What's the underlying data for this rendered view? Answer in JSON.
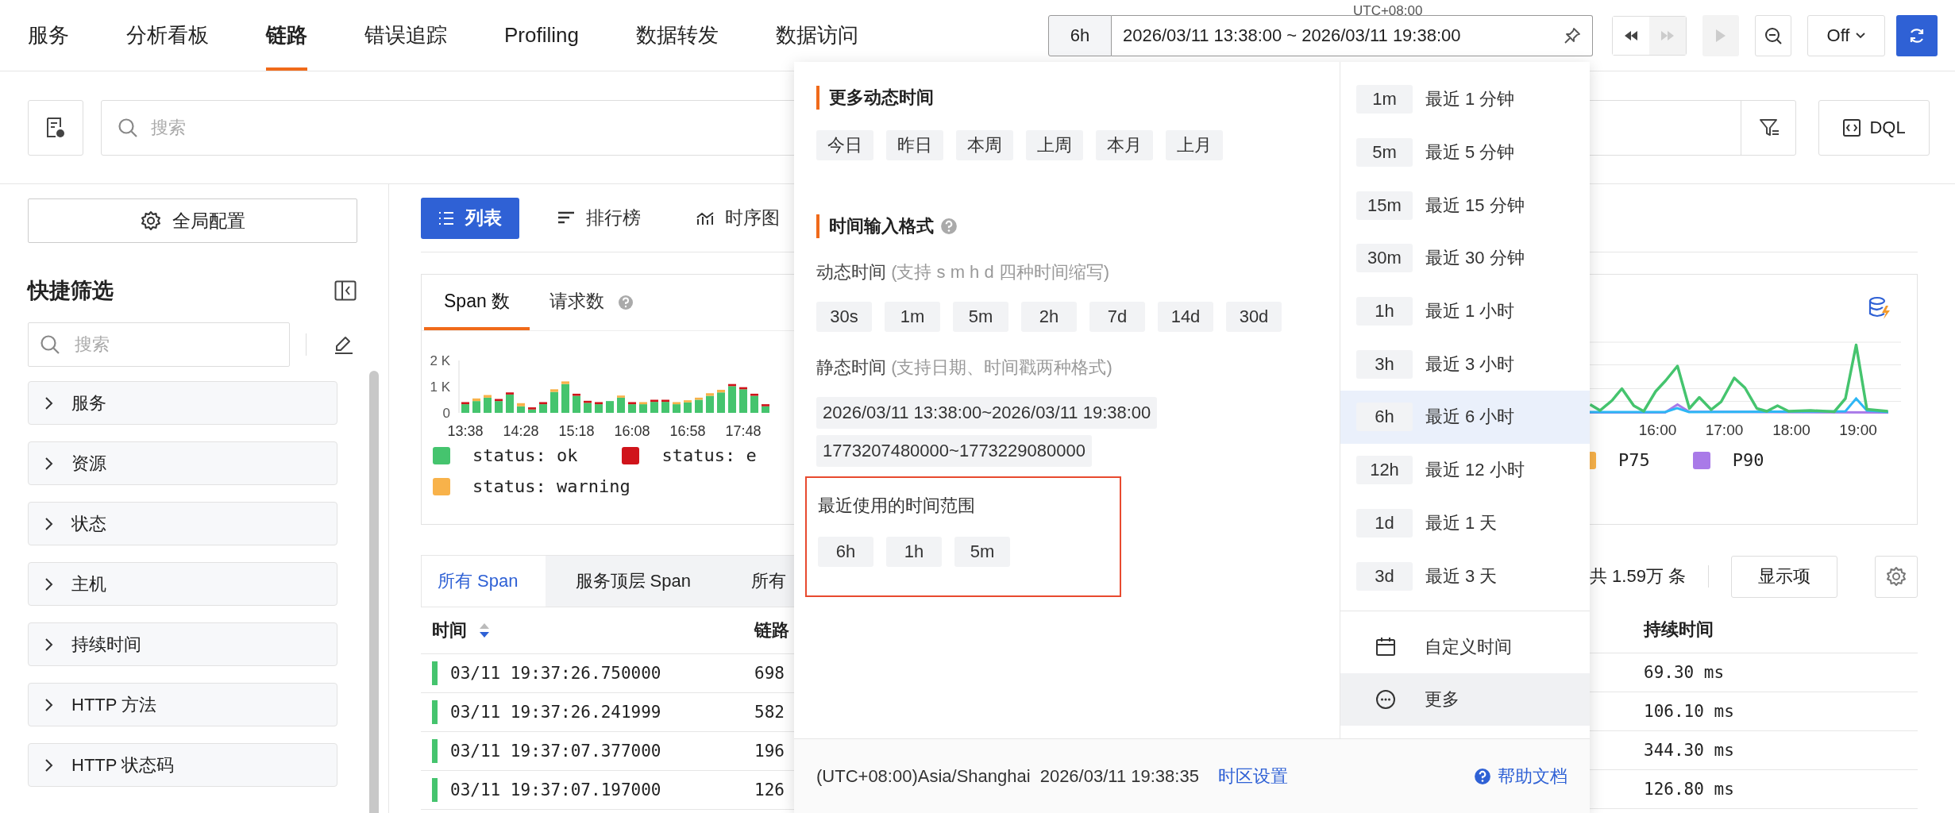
{
  "nav": {
    "tabs": [
      {
        "label": "服务",
        "selected": false
      },
      {
        "label": "分析看板",
        "selected": false
      },
      {
        "label": "链路",
        "selected": true
      },
      {
        "label": "错误追踪",
        "selected": false
      },
      {
        "label": "Profiling",
        "selected": false
      },
      {
        "label": "数据转发",
        "selected": false
      },
      {
        "label": "数据访问",
        "selected": false
      }
    ]
  },
  "time_bar": {
    "timezone": "UTC+08:00",
    "preset": "6h",
    "range": "2026/03/11 13:38:00 ~ 2026/03/11 19:38:00",
    "controls": [
      {
        "kind": "rewind",
        "disabled": false
      },
      {
        "kind": "forward",
        "disabled": true
      },
      {
        "kind": "play",
        "disabled": true
      }
    ],
    "refresh": "Off"
  },
  "search": {
    "placeholder": "搜索",
    "dql": "DQL"
  },
  "sidebar": {
    "config_button": "全局配置",
    "title": "快捷筛选",
    "search_placeholder": "搜索",
    "filters": [
      {
        "label": "服务",
        "expanded": false
      },
      {
        "label": "资源",
        "expanded": false
      },
      {
        "label": "状态",
        "expanded": false
      },
      {
        "label": "主机",
        "expanded": false
      },
      {
        "label": "持续时间",
        "expanded": false
      },
      {
        "label": "HTTP 方法",
        "expanded": false
      },
      {
        "label": "HTTP 状态码",
        "expanded": false
      }
    ]
  },
  "view_tabs": [
    {
      "kind": "list",
      "label": "列表",
      "selected": true
    },
    {
      "kind": "ranking",
      "label": "排行榜",
      "selected": false
    },
    {
      "kind": "series",
      "label": "时序图",
      "selected": false
    }
  ],
  "span_chart": {
    "tabs": [
      {
        "label": "Span 数",
        "selected": true,
        "help": false
      },
      {
        "label": "请求数",
        "selected": false,
        "help": true
      }
    ],
    "chart_data": {
      "type": "bar",
      "stacked": true,
      "categories": [
        "13:38",
        null,
        null,
        null,
        null,
        "14:28",
        null,
        null,
        null,
        null,
        "15:18",
        null,
        null,
        null,
        null,
        "16:08",
        null,
        null,
        null,
        null,
        "16:58",
        null,
        null,
        null,
        null,
        "17:48",
        null,
        null
      ],
      "ylim": [
        0,
        2000
      ],
      "yticks": [
        {
          "value": 0,
          "label": "0"
        },
        {
          "value": 1000,
          "label": "1 K"
        },
        {
          "value": 2000,
          "label": "2 K"
        }
      ],
      "series": [
        {
          "name": "status: ok",
          "color": "#45c46e",
          "values": [
            330,
            450,
            580,
            450,
            700,
            250,
            130,
            330,
            800,
            1100,
            650,
            380,
            330,
            450,
            580,
            330,
            330,
            420,
            420,
            330,
            400,
            500,
            650,
            780,
            1020,
            900,
            650,
            250
          ]
        },
        {
          "name": "status: e",
          "color": "#d0141b",
          "values": [
            80,
            0,
            0,
            80,
            80,
            0,
            80,
            80,
            0,
            0,
            80,
            80,
            80,
            0,
            0,
            80,
            0,
            80,
            80,
            0,
            0,
            0,
            0,
            0,
            80,
            80,
            80,
            80
          ]
        },
        {
          "name": "status: warning",
          "color": "#f8b24a",
          "values": [
            0,
            100,
            100,
            0,
            0,
            120,
            0,
            0,
            100,
            100,
            0,
            0,
            0,
            0,
            80,
            0,
            80,
            0,
            0,
            80,
            80,
            80,
            100,
            100,
            0,
            0,
            0,
            0
          ]
        }
      ]
    }
  },
  "latency_chart": {
    "x_labels": [
      "16:00",
      "17:00",
      "18:00",
      "19:00"
    ],
    "legend": [
      {
        "label": "P75",
        "color": "#f8b24a"
      },
      {
        "label": "P90",
        "color": "#a97ae8"
      }
    ]
  },
  "span_table": {
    "tabs": [
      {
        "label": "所有 Span",
        "selected": true
      },
      {
        "label": "服务顶层 Span",
        "selected": false
      },
      {
        "label": "所有",
        "selected": false
      }
    ],
    "total": "共 1.59万 条",
    "columns_button": "显示项",
    "columns": [
      "时间",
      "链路",
      "持续时间"
    ],
    "rows": [
      {
        "time": "03/11 19:37:26.750000",
        "trace": "698",
        "duration": "69.30 ms",
        "color": "#45c46e"
      },
      {
        "time": "03/11 19:37:26.241999",
        "trace": "582",
        "duration": "106.10 ms",
        "color": "#45c46e"
      },
      {
        "time": "03/11 19:37:07.377000",
        "trace": "196",
        "duration": "344.30 ms",
        "color": "#45c46e"
      },
      {
        "time": "03/11 19:37:07.197000",
        "trace": "126",
        "duration": "126.80 ms",
        "color": "#45c46e"
      }
    ]
  },
  "time_picker": {
    "dynamic_title": "更多动态时间",
    "dynamic_chips": [
      "今日",
      "昨日",
      "本周",
      "上周",
      "本月",
      "上月"
    ],
    "format_title": "时间输入格式",
    "dynamic_format": {
      "label": "动态时间",
      "hint": "(支持 s m h d 四种时间缩写)",
      "chips": [
        "30s",
        "1m",
        "5m",
        "2h",
        "7d",
        "14d",
        "30d"
      ]
    },
    "static_format": {
      "label": "静态时间",
      "hint": "(支持日期、时间戳两种格式)",
      "examples": [
        "2026/03/11 13:38:00~2026/03/11 19:38:00",
        "1773207480000~1773229080000"
      ]
    },
    "recent": {
      "title": "最近使用的时间范围",
      "highlighted": true,
      "chips": [
        "6h",
        "1h",
        "5m"
      ]
    },
    "quick_ranges": [
      {
        "short": "1m",
        "label": "最近 1 分钟",
        "selected": false
      },
      {
        "short": "5m",
        "label": "最近 5 分钟",
        "selected": false
      },
      {
        "short": "15m",
        "label": "最近 15 分钟",
        "selected": false
      },
      {
        "short": "30m",
        "label": "最近 30 分钟",
        "selected": false
      },
      {
        "short": "1h",
        "label": "最近 1 小时",
        "selected": false
      },
      {
        "short": "3h",
        "label": "最近 3 小时",
        "selected": false
      },
      {
        "short": "6h",
        "label": "最近 6 小时",
        "selected": true
      },
      {
        "short": "12h",
        "label": "最近 12 小时",
        "selected": false
      },
      {
        "short": "1d",
        "label": "最近 1 天",
        "selected": false
      },
      {
        "short": "3d",
        "label": "最近 3 天",
        "selected": false
      }
    ],
    "actions": [
      {
        "kind": "calendar",
        "label": "自定义时间",
        "hovered": false
      },
      {
        "kind": "more",
        "label": "更多",
        "hovered": true
      }
    ],
    "footer": {
      "timezone": "(UTC+08:00)Asia/Shanghai",
      "now": "2026/03/11 19:38:35",
      "tz_link": "时区设置",
      "help": "帮助文档"
    }
  }
}
